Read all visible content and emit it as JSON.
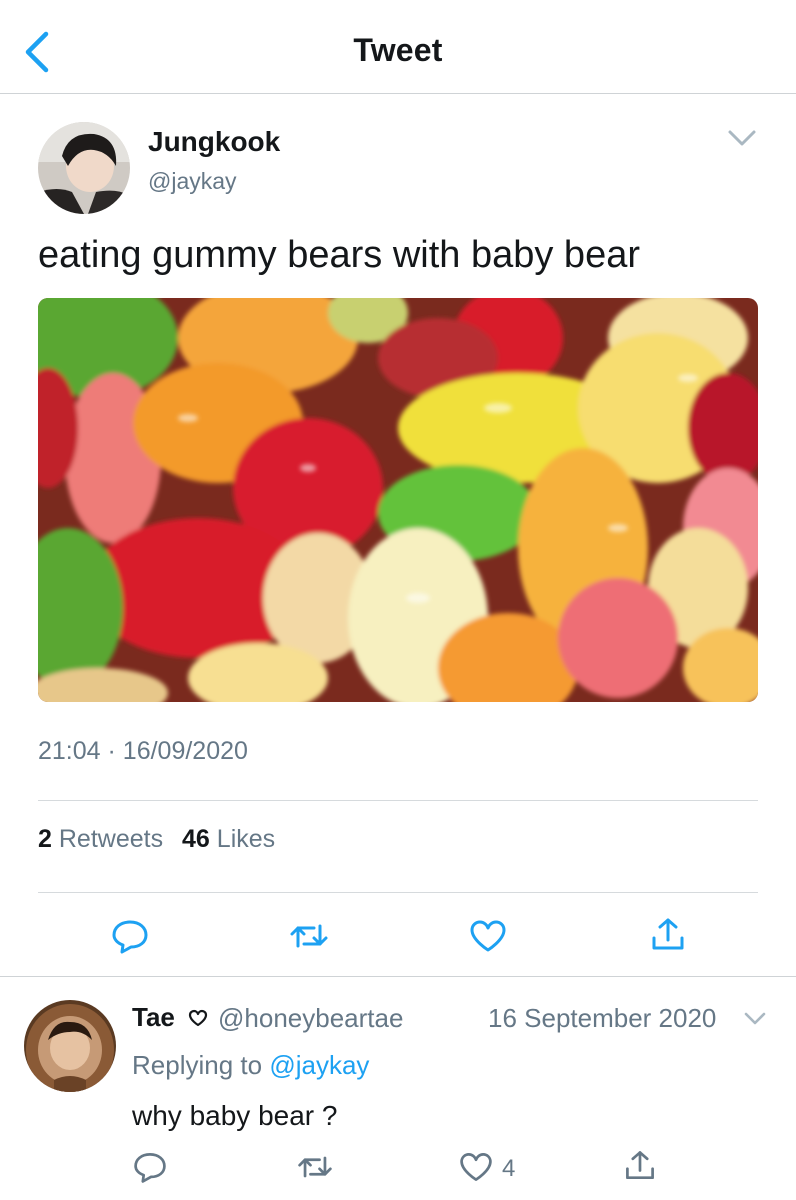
{
  "nav": {
    "title": "Tweet"
  },
  "tweet": {
    "author_name": "Jungkook",
    "author_handle": "@jaykay",
    "text": "eating gummy bears with baby bear",
    "image_alt": "gummy bears photo",
    "time": "21:04",
    "separator": "·",
    "date": "16/09/2020",
    "retweet_count": "2",
    "retweet_label": "Retweets",
    "like_count": "46",
    "like_label": "Likes"
  },
  "reply": {
    "author_name": "Tae",
    "author_handle": "@honeybeartae",
    "date": "16 September 2020",
    "replying_prefix": "Replying to",
    "replying_to": "@jaykay",
    "text": "why baby bear ?",
    "like_count": "4"
  },
  "colors": {
    "accent": "#1da1f2",
    "secondary_text": "#657786",
    "icon": "#1da1f2",
    "divider": "#d6dadd"
  },
  "icons": [
    "back-chevron-icon",
    "chevron-down-icon",
    "reply-icon",
    "retweet-icon",
    "like-icon",
    "share-icon",
    "heart-icon"
  ]
}
